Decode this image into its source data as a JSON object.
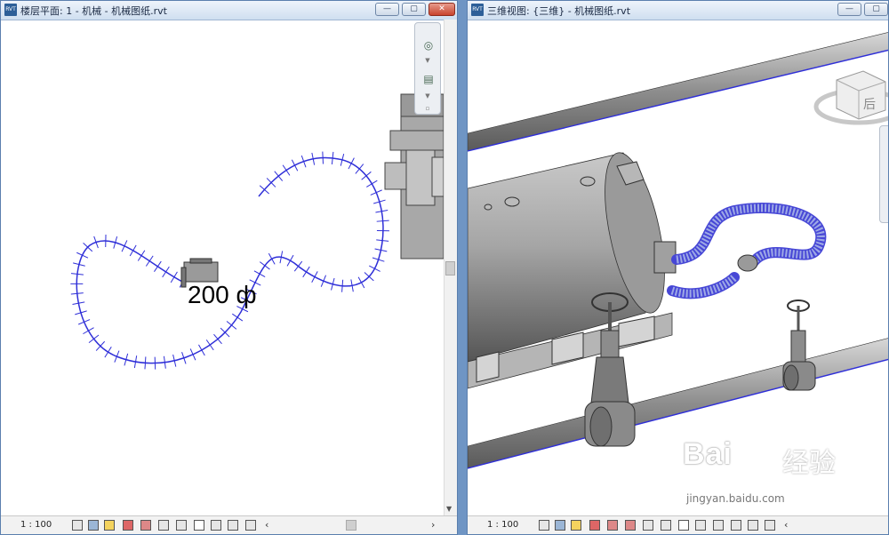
{
  "left_window": {
    "title": "楼层平面: 1 - 机械 - 机械图纸.rvt",
    "icon": "RVT",
    "annotation": "200 ф",
    "scale": "1 : 100",
    "buttons": {
      "minimize": "—",
      "restore": "▢",
      "close": "✕"
    }
  },
  "right_window": {
    "title": "三维视图: {三维} - 机械图纸.rvt",
    "icon": "RVT",
    "viewcube_face": "后",
    "scale": "1 : 100",
    "buttons": {
      "minimize": "—",
      "restore": "▢"
    }
  },
  "watermark": {
    "brand": "Bai",
    "cn": "经验",
    "url": "jingyan.baidu.com"
  },
  "colors": {
    "pipe_outline": "#2f2fd8",
    "titlebar": "#dbe6f3",
    "equipment_gray": "#9a9a9a"
  }
}
